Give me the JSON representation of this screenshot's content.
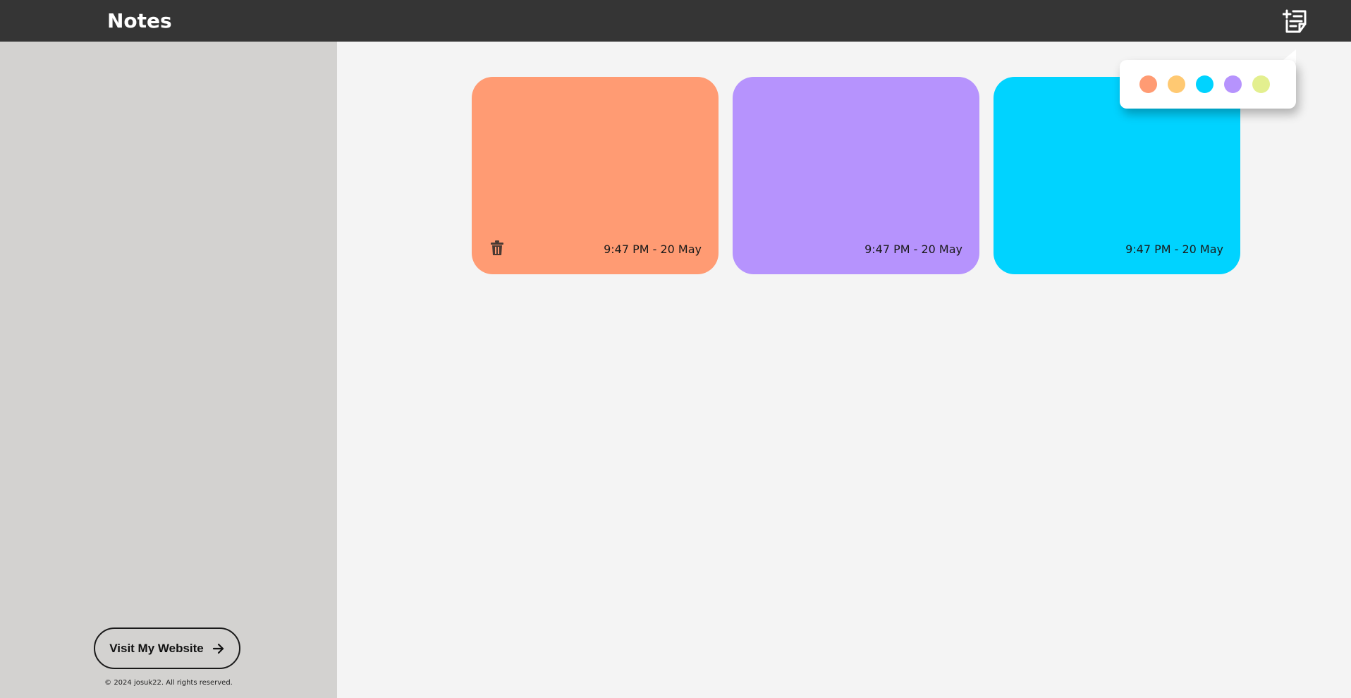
{
  "app": {
    "title": "Notes"
  },
  "sidebar": {
    "visit_button_label": "Visit My Website",
    "copyright": "© 2024 josuk22. All rights reserved."
  },
  "icons": {
    "add_note": "add-note-icon",
    "delete": "trash-icon",
    "arrow": "arrow-right-icon"
  },
  "palette": {
    "colors": [
      "#ff9b73",
      "#ffc972",
      "#00d3ff",
      "#b693fd",
      "#e3ef8f"
    ]
  },
  "notes": [
    {
      "color": "#ff9b73",
      "time": "9:47 PM - 20 May",
      "show_delete": true
    },
    {
      "color": "#b693fd",
      "time": "9:47 PM - 20 May",
      "show_delete": false
    },
    {
      "color": "#00d3ff",
      "time": "9:47 PM - 20 May",
      "show_delete": false
    }
  ],
  "theme": {
    "topbar_bg": "#353535",
    "sidebar_bg": "#d3d2d0",
    "main_bg": "#f4f4f4"
  }
}
